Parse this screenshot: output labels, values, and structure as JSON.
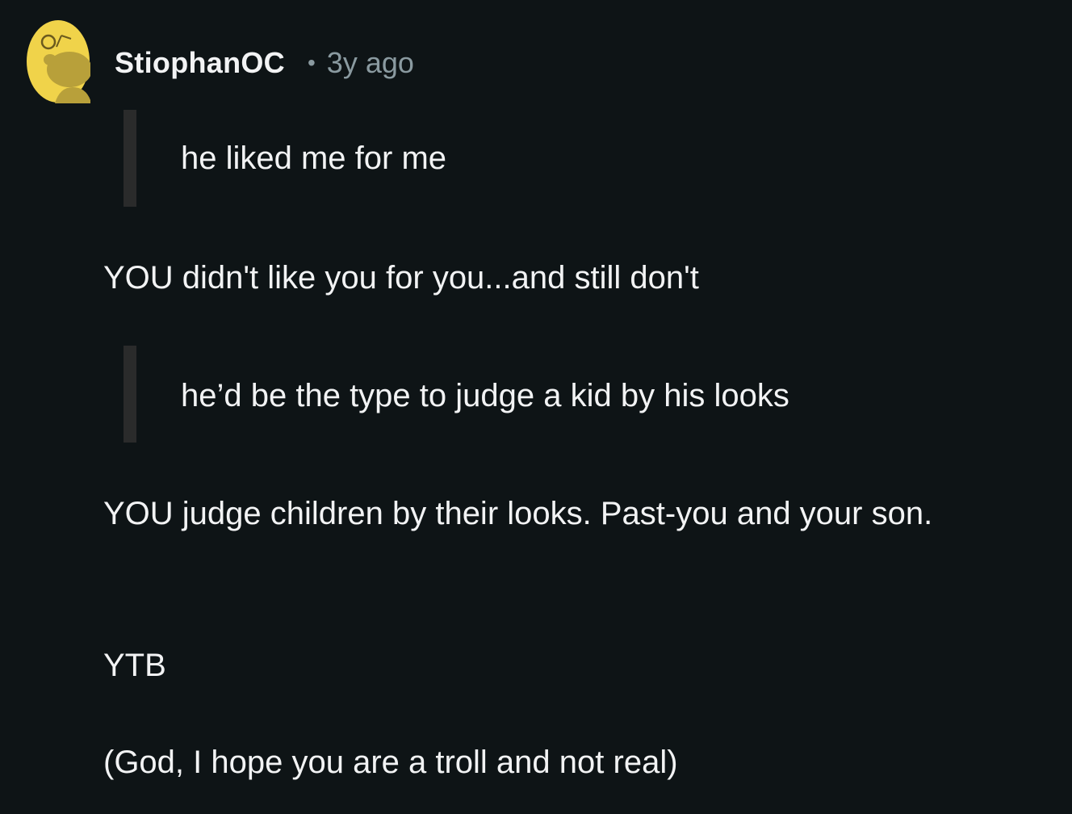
{
  "comment": {
    "author": "StiophanOC",
    "separator": "•",
    "timestamp": "3y ago",
    "avatar_icon": "reddit-snoo-avatar-icon",
    "avatar_color": "#f0d34a",
    "body": {
      "quote_1": "he liked me for me",
      "paragraph_1": "YOU didn't like you for you...and still don't",
      "quote_2": "he’d be the type to judge a kid by his looks",
      "paragraph_2": "YOU judge children by their looks. Past-you and your son.",
      "paragraph_3": "YTB",
      "paragraph_4": "(God, I hope you are a troll and not real)"
    }
  }
}
